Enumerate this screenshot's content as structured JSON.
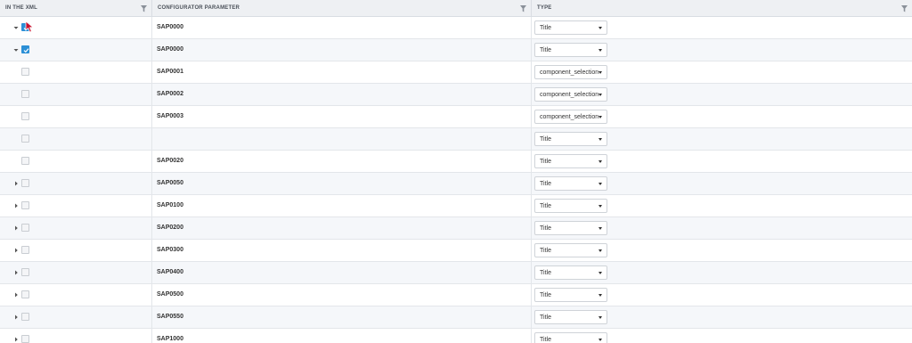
{
  "columns": [
    {
      "label": "IN THE XML"
    },
    {
      "label": "CONFIGURATOR PARAMETER"
    },
    {
      "label": "TYPE"
    }
  ],
  "rows": [
    {
      "toggle": "expanded",
      "checked": true,
      "param": "SAP0000",
      "type": "Title"
    },
    {
      "toggle": "expanded",
      "checked": true,
      "param": "SAP0000",
      "type": "Title"
    },
    {
      "toggle": "none",
      "checked": false,
      "param": "SAP0001",
      "type": "component_selection"
    },
    {
      "toggle": "none",
      "checked": false,
      "param": "SAP0002",
      "type": "component_selection"
    },
    {
      "toggle": "none",
      "checked": false,
      "param": "SAP0003",
      "type": "component_selection"
    },
    {
      "toggle": "none",
      "checked": false,
      "param": "",
      "type": "Title"
    },
    {
      "toggle": "none",
      "checked": false,
      "param": "SAP0020",
      "type": "Title"
    },
    {
      "toggle": "collapsed",
      "checked": false,
      "param": "SAP0050",
      "type": "Title"
    },
    {
      "toggle": "collapsed",
      "checked": false,
      "param": "SAP0100",
      "type": "Title"
    },
    {
      "toggle": "collapsed",
      "checked": false,
      "param": "SAP0200",
      "type": "Title"
    },
    {
      "toggle": "collapsed",
      "checked": false,
      "param": "SAP0300",
      "type": "Title"
    },
    {
      "toggle": "collapsed",
      "checked": false,
      "param": "SAP0400",
      "type": "Title"
    },
    {
      "toggle": "collapsed",
      "checked": false,
      "param": "SAP0500",
      "type": "Title"
    },
    {
      "toggle": "collapsed",
      "checked": false,
      "param": "SAP0550",
      "type": "Title"
    },
    {
      "toggle": "collapsed",
      "checked": false,
      "param": "SAP1000",
      "type": "Title"
    }
  ],
  "icons": {
    "filter": "filter-icon",
    "expanded": "caret-down-icon",
    "collapsed": "caret-right-icon",
    "cursor": "mouse-pointer-icon"
  },
  "colors": {
    "header_bg": "#eef0f3",
    "alt_row_bg": "#f5f7fa",
    "checkbox_checked": "#2b8fd6",
    "cursor": "#c8102e"
  }
}
